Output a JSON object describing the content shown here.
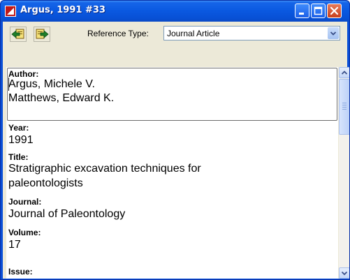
{
  "window": {
    "title": "Argus, 1991 #33"
  },
  "toolbar": {
    "reference_type_label": "Reference Type:",
    "reference_type_value": "Journal Article"
  },
  "fields": {
    "author": {
      "label": "Author:",
      "lines": [
        "Argus, Michele V.",
        "Matthews, Edward K."
      ]
    },
    "year": {
      "label": "Year:",
      "value": "1991"
    },
    "title": {
      "label": "Title:",
      "lines": [
        "Stratigraphic excavation techniques for",
        "paleontologists"
      ]
    },
    "journal": {
      "label": "Journal:",
      "value": "Journal of Paleontology"
    },
    "volume": {
      "label": "Volume:",
      "value": "17"
    },
    "issue": {
      "label": "Issue:"
    }
  },
  "colors": {
    "titlebar": "#0a58e0",
    "close_button": "#d44a24",
    "client_background": "#ece9d8",
    "scrollbar_thumb": "#c4d6f8"
  },
  "icons": {
    "app": "endnote-app-icon",
    "prev": "previous-reference-icon",
    "next": "next-reference-icon",
    "minimize": "minimize-icon",
    "maximize": "maximize-icon",
    "close": "close-icon",
    "dropdown": "chevron-down-icon"
  }
}
